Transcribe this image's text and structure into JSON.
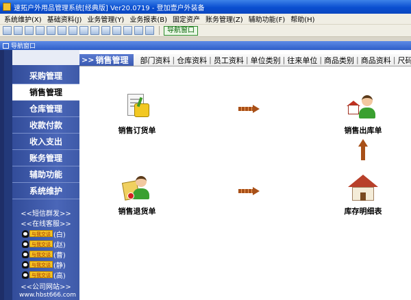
{
  "window": {
    "title": "速拓户外用品管理系统[经典版] Ver20.0719 - 登加壹户外装备"
  },
  "menubar": {
    "items": [
      {
        "label": "系统维护(X)"
      },
      {
        "label": "基础资料(J)"
      },
      {
        "label": "业务管理(Y)"
      },
      {
        "label": "业务报表(B)"
      },
      {
        "label": "固定资产"
      },
      {
        "label": "账务管理(Z)"
      },
      {
        "label": "辅助功能(F)"
      },
      {
        "label": "帮助(H)"
      }
    ]
  },
  "toolbar": {
    "nav_window_label": "导航窗口"
  },
  "panel": {
    "title": "导航窗口"
  },
  "sidebar": {
    "items": [
      {
        "label": "采购管理"
      },
      {
        "label": "销售管理",
        "active": true
      },
      {
        "label": "仓库管理"
      },
      {
        "label": "收款付款"
      },
      {
        "label": "收入支出"
      },
      {
        "label": "账务管理"
      },
      {
        "label": "辅助功能"
      },
      {
        "label": "系统维护"
      }
    ],
    "sms_link": "<<短信群发>>",
    "support_link": "<<在线客服>>",
    "qq_badge": "与我交谈",
    "qq_contacts": [
      "(白)",
      "(赵)",
      "(曹)",
      "(静)",
      "(高)"
    ],
    "company_link": "<<公司网站>>",
    "website": "www.hbst666.com"
  },
  "tabbar": {
    "arrows": ">>",
    "section": "销售管理",
    "tabs": [
      "部门资料",
      "仓库资料",
      "员工资料",
      "单位类别",
      "往来单位",
      "商品类别",
      "商品资料",
      "尺码资料",
      "商"
    ]
  },
  "flow": {
    "sales_order": "销售订货单",
    "sales_outbound": "销售出库单",
    "sales_return": "销售退货单",
    "stock_detail": "库存明细表"
  },
  "colors": {
    "title_bar": "#0a4fd0",
    "sidebar": "#3e5aa8",
    "arrow": "#a85018"
  }
}
